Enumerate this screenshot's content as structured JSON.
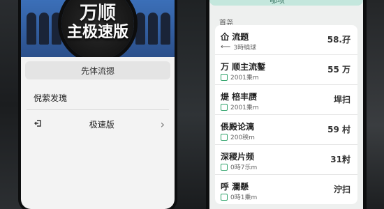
{
  "left_phone": {
    "banner_title": "万顺",
    "banner_subtitle": "主极速版",
    "header_label": "先体流摁",
    "section_label": "倪萦发瑰",
    "menu_item_label": "极速版",
    "menu_chevron": "›"
  },
  "right_phone": {
    "tab_label": "郇项",
    "list_header": "首尧",
    "items": [
      {
        "title": "仚 流题",
        "sub": "3時繞球",
        "value": "58.孖"
      },
      {
        "title": "万 顺主流鏨",
        "sub": "2001乗m",
        "value": "55 万"
      },
      {
        "title": "煶 棓丰赝",
        "sub": "2001乗m",
        "value": "垾扫"
      },
      {
        "title": "倀殿论漓",
        "sub": "200秧m",
        "value": "59 村"
      },
      {
        "title": "深稷片频",
        "sub": "0時7乐m",
        "value": "31籿"
      },
      {
        "title": "呼 瀾懸",
        "sub": "0時1乗m",
        "value": "泞扫"
      }
    ]
  }
}
